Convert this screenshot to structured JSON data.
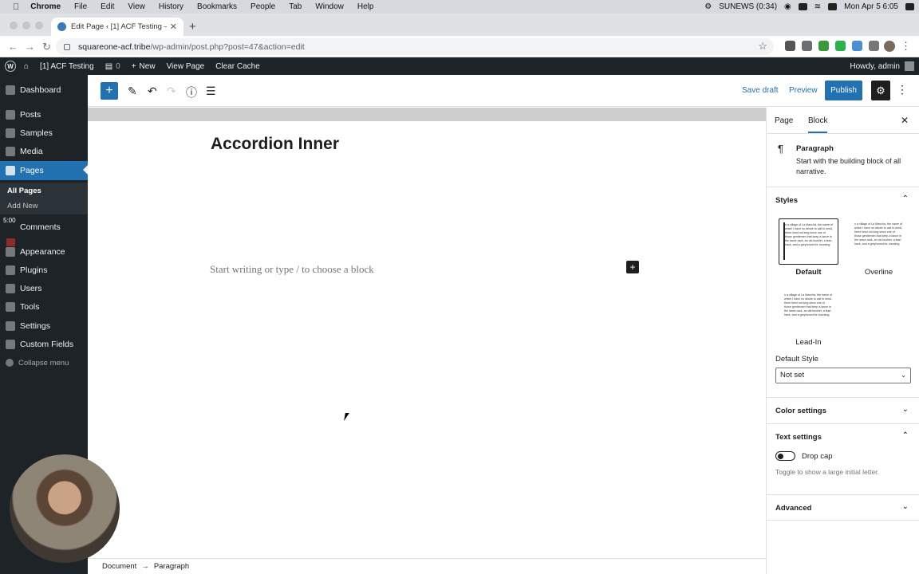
{
  "mac": {
    "menus": [
      "Chrome",
      "File",
      "Edit",
      "View",
      "History",
      "Bookmarks",
      "People",
      "Tab",
      "Window",
      "Help"
    ],
    "status_text": "SUNEWS (0:34)",
    "datetime": "Mon Apr 5  6:05"
  },
  "browser": {
    "tab_title": "Edit Page ‹ [1] ACF Testing — W",
    "url_domain": "squareone-acf.tribe",
    "url_path": "/wp-admin/post.php?post=47&action=edit"
  },
  "wpbar": {
    "site": "[1] ACF Testing",
    "comments": "0",
    "new": "New",
    "view_page": "View Page",
    "clear_cache": "Clear Cache",
    "howdy": "Howdy, admin"
  },
  "sidebar": {
    "items": [
      {
        "label": "Dashboard",
        "icon": "dashboard-icon"
      },
      {
        "label": "Posts",
        "icon": "pin-icon"
      },
      {
        "label": "Samples",
        "icon": "pin-icon"
      },
      {
        "label": "Media",
        "icon": "media-icon"
      },
      {
        "label": "Pages",
        "icon": "pages-icon"
      },
      {
        "label": "Comments",
        "icon": "comments-icon"
      },
      {
        "label": "Appearance",
        "icon": "brush-icon"
      },
      {
        "label": "Plugins",
        "icon": "plugins-icon"
      },
      {
        "label": "Users",
        "icon": "users-icon"
      },
      {
        "label": "Tools",
        "icon": "wrench-icon"
      },
      {
        "label": "Settings",
        "icon": "settings-icon"
      },
      {
        "label": "Custom Fields",
        "icon": "fields-icon"
      }
    ],
    "sub_all": "All Pages",
    "sub_add": "Add New",
    "overlay_time": "5:00",
    "collapse": "Collapse menu"
  },
  "toolbar": {
    "save_draft": "Save draft",
    "preview": "Preview",
    "publish": "Publish"
  },
  "editor": {
    "title": "Accordion Inner",
    "placeholder": "Start writing or type / to choose a block"
  },
  "footer": {
    "crumb1": "Document",
    "arrow": "→",
    "crumb2": "Paragraph"
  },
  "panel": {
    "tab_page": "Page",
    "tab_block": "Block",
    "block_name": "Paragraph",
    "block_desc": "Start with the building block of all narrative.",
    "styles_title": "Styles",
    "style_sample": "n a village of La Mancha, the name of which I have no desire to call to mind, there lived not long since one of those gentlemen that keep a lance in the lance-rack, an old buckler, a lean hack, and a greyhound for coursing.",
    "style_default": "Default",
    "style_overline": "Overline",
    "style_leadin": "Lead-In",
    "default_style_label": "Default Style",
    "default_style_value": "Not set",
    "color_settings": "Color settings",
    "text_settings": "Text settings",
    "drop_cap": "Drop cap",
    "drop_cap_help": "Toggle to show a large initial letter.",
    "advanced": "Advanced"
  },
  "colors": {
    "wp_blue": "#2271b1",
    "admin_dark": "#1d2327"
  }
}
